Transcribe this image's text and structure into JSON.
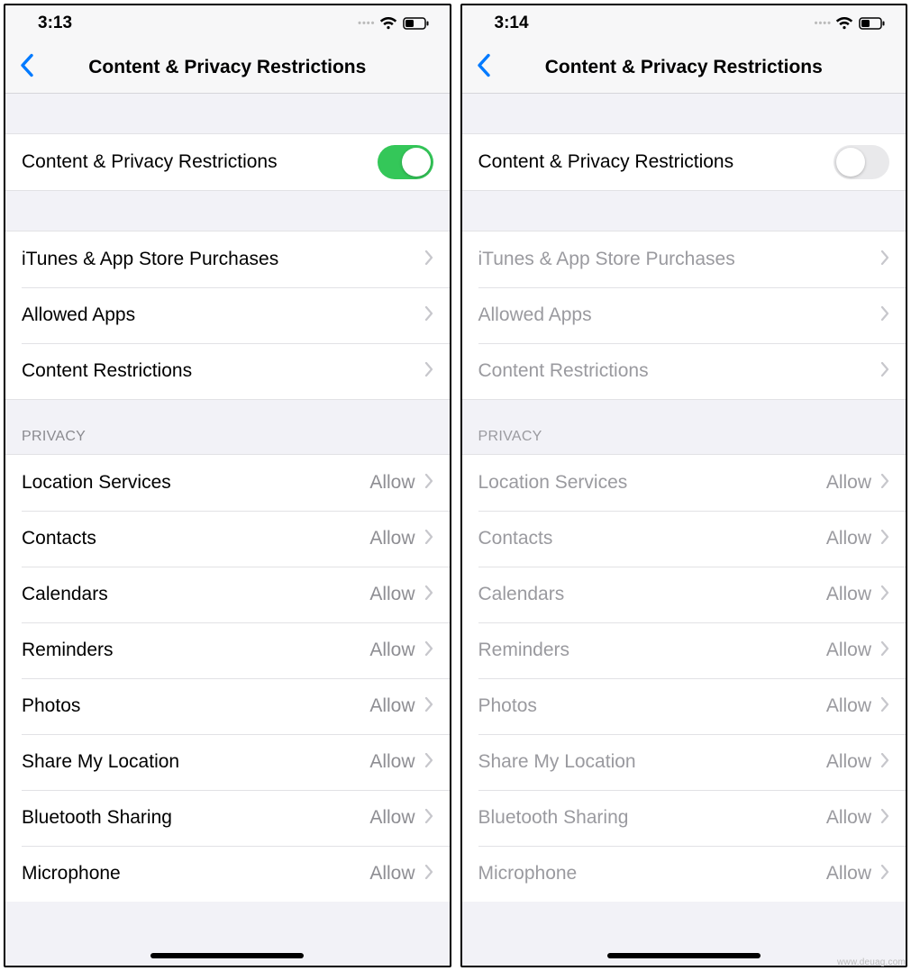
{
  "watermark": "www.deuag.com",
  "screens": [
    {
      "time": "3:13",
      "nav_title": "Content & Privacy Restrictions",
      "toggle_on": true,
      "toggle_label": "Content & Privacy Restrictions",
      "group1": [
        {
          "label": "iTunes & App Store Purchases"
        },
        {
          "label": "Allowed Apps"
        },
        {
          "label": "Content Restrictions"
        }
      ],
      "privacy_header": "PRIVACY",
      "privacy_items": [
        {
          "label": "Location Services",
          "value": "Allow"
        },
        {
          "label": "Contacts",
          "value": "Allow"
        },
        {
          "label": "Calendars",
          "value": "Allow"
        },
        {
          "label": "Reminders",
          "value": "Allow"
        },
        {
          "label": "Photos",
          "value": "Allow"
        },
        {
          "label": "Share My Location",
          "value": "Allow"
        },
        {
          "label": "Bluetooth Sharing",
          "value": "Allow"
        },
        {
          "label": "Microphone",
          "value": "Allow"
        }
      ]
    },
    {
      "time": "3:14",
      "nav_title": "Content & Privacy Restrictions",
      "toggle_on": false,
      "toggle_label": "Content & Privacy Restrictions",
      "group1": [
        {
          "label": "iTunes & App Store Purchases"
        },
        {
          "label": "Allowed Apps"
        },
        {
          "label": "Content Restrictions"
        }
      ],
      "privacy_header": "PRIVACY",
      "privacy_items": [
        {
          "label": "Location Services",
          "value": "Allow"
        },
        {
          "label": "Contacts",
          "value": "Allow"
        },
        {
          "label": "Calendars",
          "value": "Allow"
        },
        {
          "label": "Reminders",
          "value": "Allow"
        },
        {
          "label": "Photos",
          "value": "Allow"
        },
        {
          "label": "Share My Location",
          "value": "Allow"
        },
        {
          "label": "Bluetooth Sharing",
          "value": "Allow"
        },
        {
          "label": "Microphone",
          "value": "Allow"
        }
      ]
    }
  ]
}
